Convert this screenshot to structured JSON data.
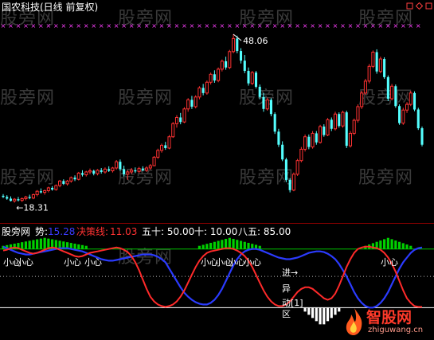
{
  "header": {
    "title": "国农科技(日线 前复权)"
  },
  "window_icons": [
    "restore-icon",
    "zoom-icon",
    "close-icon"
  ],
  "watermarks": [
    "股旁网",
    "股旁网",
    "股旁网",
    "股旁网",
    "股旁网",
    "股旁网",
    "股旁网",
    "股旁网",
    "股旁网",
    "股旁网",
    "股旁网",
    "股旁网",
    "股旁网"
  ],
  "indicator_header": {
    "name": "股旁网",
    "shi_label": "势:",
    "shi_value": "15.28",
    "juece_label": "决策线:",
    "juece_value": "11.03",
    "level1": "五十: 50.00",
    "level2": "十: 10.00",
    "level3": "八五: 85.00"
  },
  "logo": {
    "name": "智股网",
    "url": "zhiguwang.cn"
  },
  "colors": {
    "up": "#ff3232",
    "down": "#54ffff",
    "shi_line": "#2b3bff",
    "juece_line": "#ff2a2a",
    "green_line": "#00c000",
    "header_shi": "#3b3bff",
    "header_juece": "#ff3232",
    "marks": "#ff40ff",
    "bars": "#00d000"
  },
  "chart_data": [
    {
      "type": "candlestick",
      "title": "国农科技(日线 前复权)",
      "annotations": [
        {
          "text": "48.06",
          "note": "high"
        },
        {
          "text": "←18.31",
          "note": "low"
        }
      ],
      "ylim": [
        16.5,
        51
      ],
      "candles": [
        [
          19.6,
          19.9,
          19.2,
          19.4
        ],
        [
          19.4,
          19.7,
          18.9,
          19.1
        ],
        [
          19.1,
          19.5,
          18.6,
          18.7
        ],
        [
          18.7,
          19.2,
          18.4,
          19.0
        ],
        [
          19.0,
          19.4,
          18.6,
          18.8
        ],
        [
          18.8,
          19.3,
          18.5,
          19.1
        ],
        [
          19.1,
          19.6,
          18.8,
          19.4
        ],
        [
          19.4,
          19.8,
          19.0,
          19.2
        ],
        [
          19.2,
          20.0,
          19.0,
          19.8
        ],
        [
          19.8,
          20.6,
          19.5,
          20.4
        ],
        [
          20.4,
          20.9,
          20.0,
          20.2
        ],
        [
          20.2,
          20.7,
          19.8,
          20.5
        ],
        [
          20.5,
          21.2,
          20.2,
          21.0
        ],
        [
          21.0,
          21.3,
          20.5,
          20.7
        ],
        [
          20.7,
          21.6,
          20.5,
          21.4
        ],
        [
          21.4,
          22.4,
          21.1,
          22.2
        ],
        [
          22.2,
          22.5,
          21.5,
          21.7
        ],
        [
          21.7,
          22.4,
          21.4,
          22.2
        ],
        [
          22.2,
          23.0,
          21.9,
          22.8
        ],
        [
          22.8,
          23.2,
          22.2,
          22.5
        ],
        [
          22.5,
          23.8,
          22.3,
          23.6
        ],
        [
          23.6,
          24.1,
          23.0,
          23.3
        ],
        [
          23.3,
          24.0,
          23.0,
          23.8
        ],
        [
          23.8,
          24.4,
          23.4,
          24.0
        ],
        [
          24.0,
          24.2,
          23.2,
          23.5
        ],
        [
          23.5,
          24.3,
          23.2,
          24.1
        ],
        [
          24.1,
          24.5,
          23.5,
          23.8
        ],
        [
          23.8,
          24.6,
          23.5,
          24.3
        ],
        [
          24.3,
          24.8,
          23.8,
          24.0
        ],
        [
          24.0,
          24.7,
          23.7,
          24.5
        ],
        [
          24.5,
          25.9,
          24.2,
          25.6
        ],
        [
          25.6,
          26.0,
          24.0,
          24.3
        ],
        [
          24.3,
          24.9,
          23.0,
          23.4
        ],
        [
          23.4,
          24.1,
          22.4,
          23.8
        ],
        [
          23.8,
          24.5,
          23.4,
          24.1
        ],
        [
          24.1,
          24.6,
          23.6,
          23.9
        ],
        [
          23.9,
          24.7,
          23.6,
          24.4
        ],
        [
          24.4,
          24.8,
          23.9,
          24.1
        ],
        [
          24.1,
          24.8,
          23.8,
          24.5
        ],
        [
          24.5,
          25.2,
          24.2,
          24.9
        ],
        [
          24.9,
          26.6,
          24.8,
          26.4
        ],
        [
          26.4,
          27.9,
          26.1,
          27.6
        ],
        [
          27.6,
          28.8,
          27.2,
          28.5
        ],
        [
          28.5,
          29.1,
          27.7,
          28.0
        ],
        [
          28.0,
          30.3,
          27.8,
          30.0
        ],
        [
          30.0,
          32.6,
          29.8,
          32.3
        ],
        [
          32.3,
          33.8,
          31.6,
          33.4
        ],
        [
          33.4,
          34.2,
          32.2,
          32.6
        ],
        [
          32.6,
          35.2,
          32.4,
          34.9
        ],
        [
          34.9,
          36.8,
          34.4,
          36.5
        ],
        [
          36.5,
          37.2,
          34.9,
          35.3
        ],
        [
          35.3,
          37.3,
          35.0,
          37.0
        ],
        [
          37.0,
          38.9,
          36.6,
          38.6
        ],
        [
          38.6,
          39.3,
          37.3,
          37.7
        ],
        [
          37.7,
          39.9,
          37.4,
          39.6
        ],
        [
          39.6,
          41.3,
          39.2,
          41.0
        ],
        [
          41.0,
          41.7,
          39.5,
          39.9
        ],
        [
          39.9,
          42.2,
          39.6,
          41.9
        ],
        [
          41.9,
          43.6,
          41.5,
          43.3
        ],
        [
          43.3,
          44.1,
          41.8,
          42.2
        ],
        [
          42.2,
          45.3,
          41.9,
          45.0
        ],
        [
          45.0,
          48.06,
          44.7,
          47.3
        ],
        [
          47.3,
          47.8,
          44.7,
          45.1
        ],
        [
          45.1,
          45.6,
          42.9,
          43.4
        ],
        [
          43.4,
          44.4,
          41.2,
          41.6
        ],
        [
          41.6,
          42.2,
          39.0,
          39.4
        ],
        [
          39.4,
          41.6,
          39.1,
          41.3
        ],
        [
          41.3,
          41.6,
          38.5,
          38.8
        ],
        [
          38.8,
          39.2,
          36.6,
          37.0
        ],
        [
          37.0,
          37.7,
          34.4,
          34.9
        ],
        [
          34.9,
          36.9,
          34.6,
          36.5
        ],
        [
          36.5,
          36.8,
          33.6,
          34.0
        ],
        [
          34.0,
          34.3,
          30.5,
          30.9
        ],
        [
          30.9,
          31.4,
          28.2,
          28.6
        ],
        [
          28.6,
          29.2,
          25.7,
          26.0
        ],
        [
          26.0,
          26.3,
          22.0,
          22.4
        ],
        [
          22.4,
          22.7,
          20.2,
          20.6
        ],
        [
          20.6,
          23.7,
          20.4,
          23.4
        ],
        [
          23.4,
          26.1,
          23.1,
          25.8
        ],
        [
          25.8,
          28.2,
          25.5,
          27.8
        ],
        [
          27.8,
          30.4,
          27.4,
          30.0
        ],
        [
          30.0,
          30.4,
          27.8,
          28.2
        ],
        [
          28.2,
          31.0,
          27.9,
          30.6
        ],
        [
          30.6,
          31.0,
          28.6,
          29.0
        ],
        [
          29.0,
          32.1,
          28.8,
          31.8
        ],
        [
          31.8,
          32.2,
          30.0,
          30.3
        ],
        [
          30.3,
          33.3,
          30.1,
          33.0
        ],
        [
          33.0,
          33.4,
          31.0,
          31.4
        ],
        [
          31.4,
          34.4,
          31.1,
          34.0
        ],
        [
          34.0,
          34.3,
          31.6,
          31.9
        ],
        [
          31.9,
          34.6,
          31.6,
          34.3
        ],
        [
          34.3,
          34.6,
          28.0,
          28.4
        ],
        [
          28.4,
          31.0,
          28.1,
          30.6
        ],
        [
          30.6,
          33.2,
          30.3,
          32.9
        ],
        [
          32.9,
          35.7,
          32.5,
          35.3
        ],
        [
          35.3,
          38.1,
          34.9,
          37.7
        ],
        [
          37.7,
          40.2,
          37.4,
          39.8
        ],
        [
          39.8,
          42.8,
          39.4,
          42.4
        ],
        [
          42.4,
          45.2,
          42.1,
          44.9
        ],
        [
          44.9,
          45.4,
          41.1,
          41.5
        ],
        [
          41.5,
          44.1,
          41.2,
          43.7
        ],
        [
          43.7,
          44.0,
          40.2,
          40.5
        ],
        [
          40.5,
          40.8,
          36.3,
          36.7
        ],
        [
          36.7,
          39.3,
          36.4,
          38.9
        ],
        [
          38.9,
          39.2,
          35.1,
          35.4
        ],
        [
          35.4,
          35.7,
          32.1,
          32.4
        ],
        [
          32.4,
          35.1,
          32.1,
          34.7
        ],
        [
          34.7,
          36.1,
          34.2,
          35.7
        ],
        [
          35.7,
          38.1,
          35.4,
          37.7
        ],
        [
          37.7,
          38.0,
          34.5,
          34.8
        ],
        [
          34.8,
          35.1,
          31.2,
          31.5
        ],
        [
          31.5,
          31.8,
          28.3,
          28.6
        ]
      ]
    },
    {
      "type": "line",
      "series": [
        {
          "name": "势",
          "last": 15.28
        },
        {
          "name": "决策线",
          "last": 11.03
        }
      ],
      "levels": [
        50,
        10,
        85
      ],
      "ylim": [
        -8,
        100
      ],
      "x_count": 112,
      "shi": [
        88,
        86,
        84,
        82,
        80,
        79,
        78,
        78,
        79,
        80,
        81,
        82,
        83,
        84,
        85,
        86,
        86,
        86,
        85,
        84,
        83,
        82,
        80,
        78,
        76,
        74,
        72,
        71,
        70,
        70,
        71,
        72,
        73,
        74,
        75,
        76,
        77,
        78,
        78,
        78,
        77,
        75,
        72,
        68,
        60,
        52,
        44,
        36,
        29,
        24,
        20,
        17,
        15,
        14,
        14,
        16,
        20,
        26,
        34,
        44,
        54,
        64,
        72,
        78,
        82,
        84,
        85,
        85,
        84,
        82,
        80,
        78,
        76,
        74,
        73,
        72,
        72,
        73,
        74,
        76,
        78,
        80,
        81,
        82,
        82,
        81,
        79,
        76,
        72,
        66,
        58,
        50,
        40,
        30,
        22,
        16,
        12,
        10,
        10,
        12,
        16,
        22,
        30,
        40,
        50,
        60,
        68,
        74,
        80,
        84,
        86,
        87
      ],
      "juece": [
        83,
        84,
        86,
        87,
        86,
        84,
        82,
        80,
        79,
        80,
        82,
        84,
        86,
        87,
        86,
        84,
        82,
        80,
        78,
        76,
        75,
        76,
        78,
        80,
        81,
        82,
        83,
        84,
        85,
        86,
        87,
        86,
        84,
        81,
        76,
        68,
        58,
        46,
        34,
        24,
        18,
        14,
        12,
        11,
        12,
        14,
        18,
        24,
        32,
        42,
        52,
        62,
        70,
        76,
        80,
        82,
        83,
        84,
        85,
        86,
        86,
        85,
        83,
        80,
        76,
        70,
        62,
        52,
        42,
        32,
        24,
        18,
        14,
        12,
        12,
        14,
        18,
        24,
        30,
        34,
        36,
        36,
        34,
        30,
        26,
        22,
        20,
        22,
        28,
        38,
        50,
        62,
        72,
        80,
        85,
        87,
        88,
        88,
        87,
        86,
        84,
        80,
        74,
        66,
        56,
        44,
        32,
        22,
        16,
        12,
        11,
        11
      ],
      "bars": [
        {
          "start": 0,
          "end": 22
        },
        {
          "start": 52,
          "end": 68
        },
        {
          "start": 96,
          "end": 108
        }
      ],
      "white_bars": {
        "start": 80,
        "end": 89
      },
      "text_marks": [
        {
          "text": "小心",
          "color": "#ffffff"
        },
        {
          "text": "小心",
          "color": "#ffffff"
        },
        {
          "text": "小心",
          "color": "#ffffff"
        },
        {
          "text": "小心",
          "color": "#ffffff"
        },
        {
          "text": "小心",
          "color": "#ffffff"
        },
        {
          "text": "小心",
          "color": "#ffffff"
        },
        {
          "text": "小心",
          "color": "#ffffff"
        },
        {
          "text": "小心",
          "color": "#ffffff"
        },
        {
          "text": "小心",
          "color": "#ffffff"
        },
        {
          "text": "进→",
          "color": "#ffffff"
        },
        {
          "text": "异",
          "color": "#ffffff"
        },
        {
          "text": "动[1]",
          "color": "#ffffff"
        },
        {
          "text": "区",
          "color": "#ffffff"
        }
      ]
    }
  ]
}
